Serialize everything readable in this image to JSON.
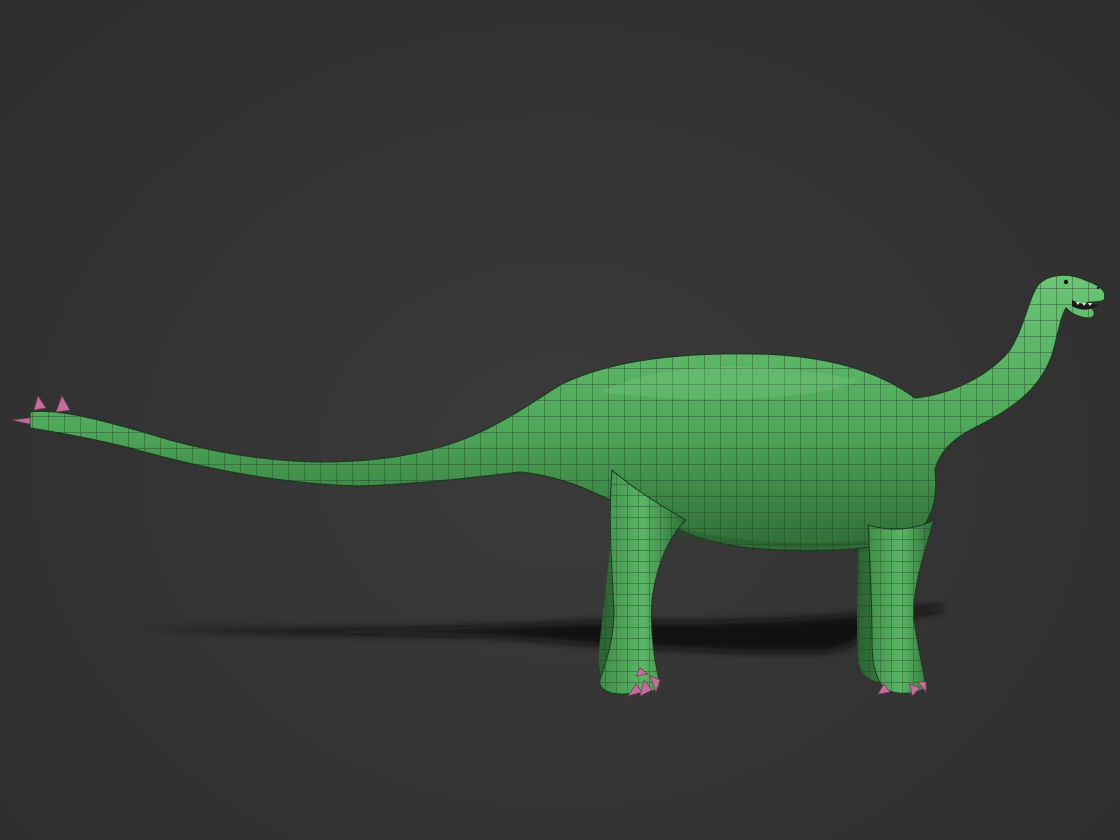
{
  "scene": {
    "subject": "sauropod-dinosaur-model",
    "colors": {
      "background": "#333333",
      "body": "#4fa85a",
      "body_light": "#6cc476",
      "body_dark": "#2f6d36",
      "wire": "#1c3a20",
      "claws": "#c0709a",
      "shadow": "#0e0e0e",
      "mouth": "#1a1a1a",
      "teeth": "#e8e8e8"
    }
  }
}
